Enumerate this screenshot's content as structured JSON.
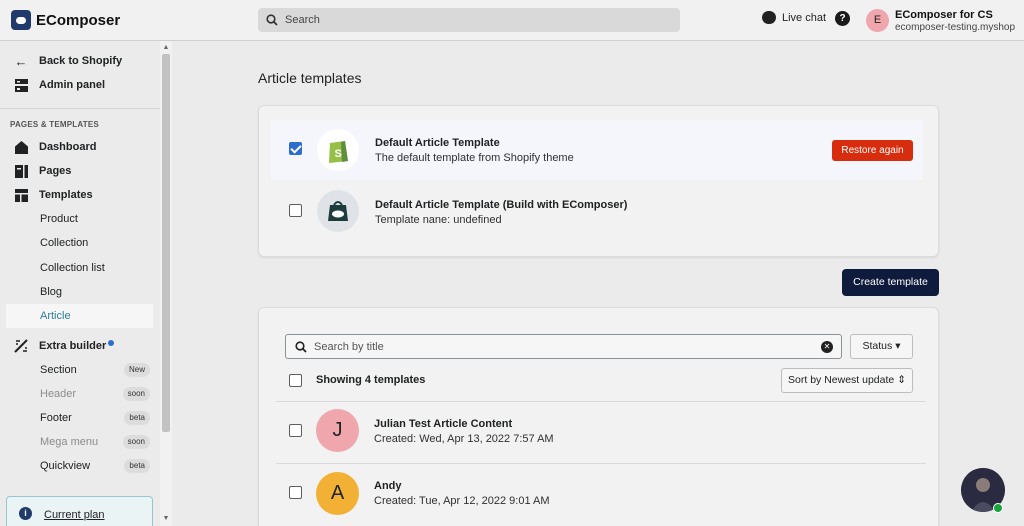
{
  "app": {
    "name": "EComposer"
  },
  "topbar": {
    "search_placeholder": "Search",
    "live_chat": "Live chat",
    "help_label": "?",
    "user_initial": "E",
    "user_name": "EComposer for CS",
    "user_domain": "ecomposer-testing.myshopif..."
  },
  "sidebar": {
    "back": "Back to Shopify",
    "admin": "Admin panel",
    "section": "PAGES & TEMPLATES",
    "dashboard": "Dashboard",
    "pages": "Pages",
    "templates": "Templates",
    "product": "Product",
    "collection": "Collection",
    "collection_list": "Collection list",
    "blog": "Blog",
    "article": "Article",
    "extra_builder": "Extra builder",
    "section_item": "Section",
    "section_badge": "New",
    "header": "Header",
    "header_badge": "soon",
    "footer": "Footer",
    "footer_badge": "beta",
    "mega_menu": "Mega menu",
    "mega_badge": "soon",
    "quickview": "Quickview",
    "quickview_badge": "beta",
    "current_plan": "Current plan"
  },
  "main": {
    "title": "Article templates",
    "templates": [
      {
        "title": "Default Article Template",
        "subtitle": "The default template from Shopify theme",
        "checked": true,
        "action": "Restore again"
      },
      {
        "title": "Default Article Template (Build with EComposer)",
        "subtitle": "Template nane: undefined",
        "checked": false
      }
    ],
    "create_button": "Create template",
    "search_placeholder": "Search by title",
    "status_button": "Status",
    "showing": "Showing 4 templates",
    "sort_button": "Sort by Newest update",
    "items": [
      {
        "initial": "J",
        "title": "Julian Test Article Content",
        "subtitle": "Created: Wed, Apr 13, 2022 7:57 AM",
        "color": "#f0a6ad"
      },
      {
        "initial": "A",
        "title": "Andy",
        "subtitle": "Created: Tue, Apr 12, 2022 9:01 AM",
        "color": "#f2b134"
      }
    ]
  },
  "colors": {
    "accent": "#2c6ecb",
    "danger": "#d72c0d",
    "primary": "#0f1b3d",
    "active_text": "#2a7f9b"
  }
}
